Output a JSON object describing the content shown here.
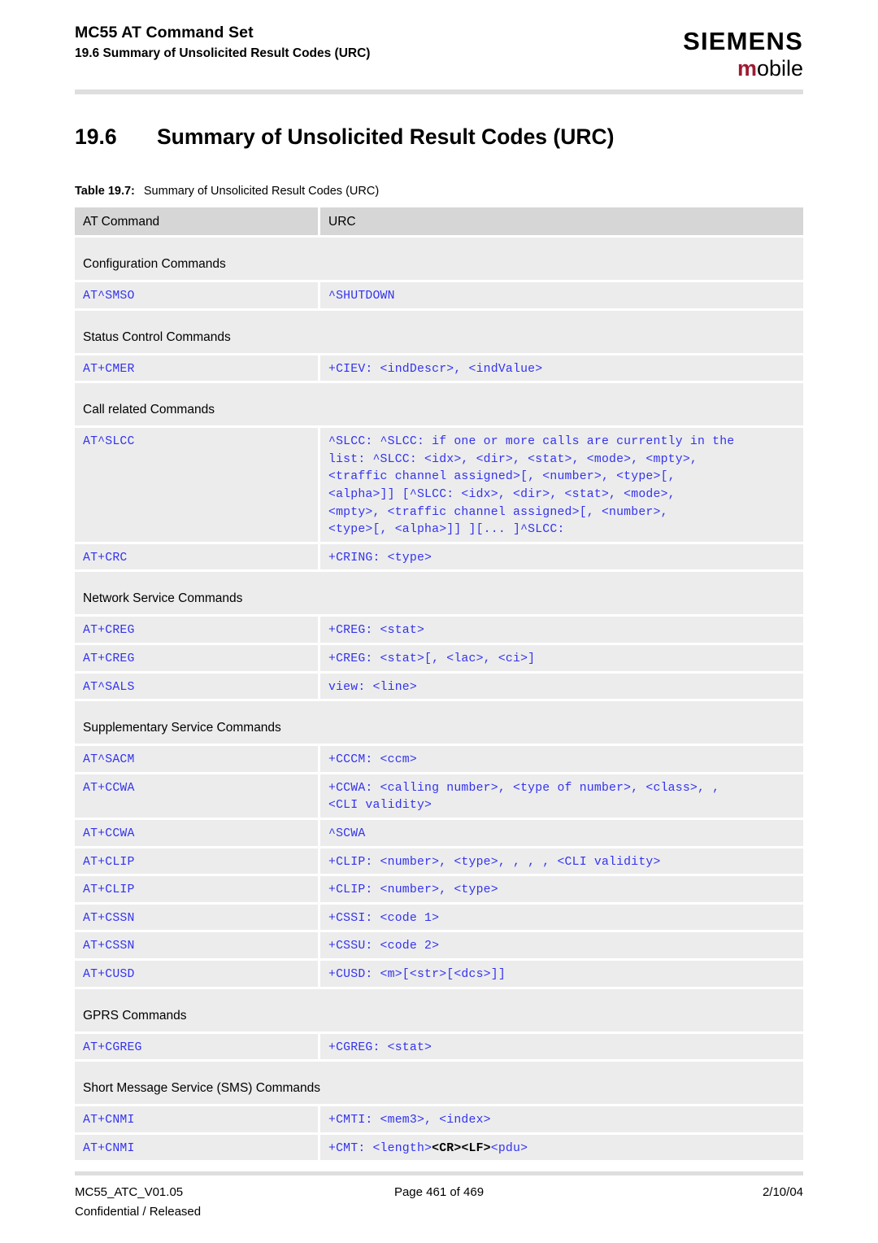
{
  "header": {
    "doc_title": "MC55 AT Command Set",
    "section_line": "19.6 Summary of Unsolicited Result Codes (URC)",
    "logo_primary": "SIEMENS",
    "logo_secondary_m": "m",
    "logo_secondary_rest": "obile",
    "brand_accent": "#9e1b32"
  },
  "title": {
    "number": "19.6",
    "text": "Summary of Unsolicited Result Codes (URC)"
  },
  "table_caption": {
    "label": "Table 19.7:",
    "text": "Summary of Unsolicited Result Codes (URC)"
  },
  "table": {
    "columns": [
      "AT Command",
      "URC"
    ],
    "rows": [
      {
        "kind": "section",
        "label": "Configuration Commands"
      },
      {
        "kind": "cmd",
        "command": "AT^SMSO",
        "urc": "^SHUTDOWN"
      },
      {
        "kind": "section",
        "label": "Status Control Commands"
      },
      {
        "kind": "cmd",
        "command": "AT+CMER",
        "urc": "+CIEV: <indDescr>, <indValue>"
      },
      {
        "kind": "section",
        "label": "Call related Commands"
      },
      {
        "kind": "cmd",
        "command": "AT^SLCC",
        "urc": "^SLCC: ^SLCC: if one or more calls are currently in the\nlist: ^SLCC: <idx>, <dir>, <stat>, <mode>, <mpty>,\n<traffic channel assigned>[, <number>, <type>[,\n<alpha>]] [^SLCC: <idx>, <dir>, <stat>, <mode>,\n<mpty>, <traffic channel assigned>[, <number>,\n<type>[, <alpha>]] ][... ]^SLCC:"
      },
      {
        "kind": "cmd",
        "command": "AT+CRC",
        "urc": "+CRING: <type>"
      },
      {
        "kind": "section",
        "label": "Network Service Commands"
      },
      {
        "kind": "cmd",
        "command": "AT+CREG",
        "urc": "+CREG: <stat>"
      },
      {
        "kind": "cmd",
        "command": "AT+CREG",
        "urc": "+CREG: <stat>[, <lac>, <ci>]"
      },
      {
        "kind": "cmd",
        "command": "AT^SALS",
        "urc": "view: <line>"
      },
      {
        "kind": "section",
        "label": "Supplementary Service Commands"
      },
      {
        "kind": "cmd",
        "command": "AT^SACM",
        "urc": "+CCCM: <ccm>"
      },
      {
        "kind": "cmd",
        "command": "AT+CCWA",
        "urc": "+CCWA: <calling number>, <type of number>, <class>, ,\n<CLI validity>"
      },
      {
        "kind": "cmd",
        "command": "AT+CCWA",
        "urc": "^SCWA"
      },
      {
        "kind": "cmd",
        "command": "AT+CLIP",
        "urc": "+CLIP: <number>, <type>, , , , <CLI validity>"
      },
      {
        "kind": "cmd",
        "command": "AT+CLIP",
        "urc": "+CLIP: <number>, <type>"
      },
      {
        "kind": "cmd",
        "command": "AT+CSSN",
        "urc": "+CSSI: <code 1>"
      },
      {
        "kind": "cmd",
        "command": "AT+CSSN",
        "urc": "+CSSU: <code 2>"
      },
      {
        "kind": "cmd",
        "command": "AT+CUSD",
        "urc": "+CUSD: <m>[<str>[<dcs>]]"
      },
      {
        "kind": "section",
        "label": "GPRS Commands"
      },
      {
        "kind": "cmd",
        "command": "AT+CGREG",
        "urc": "+CGREG: <stat>"
      },
      {
        "kind": "section",
        "label": "Short Message Service (SMS) Commands"
      },
      {
        "kind": "cmd",
        "command": "AT+CNMI",
        "urc": "+CMTI: <mem3>, <index>"
      },
      {
        "kind": "cmd",
        "command": "AT+CNMI",
        "urc_parts": [
          {
            "text": "+CMT: <length>",
            "bold": false
          },
          {
            "text": "<CR><LF>",
            "bold": true
          },
          {
            "text": "<pdu>",
            "bold": false
          }
        ],
        "urc": "+CMT: <length><CR><LF><pdu>"
      }
    ]
  },
  "footer": {
    "doc_id": "MC55_ATC_V01.05",
    "page": "Page 461 of 469",
    "date": "2/10/04",
    "classification": "Confidential / Released"
  },
  "colors": {
    "code_blue": "#3333ee",
    "row_bg": "#ececec",
    "header_row_bg": "#d6d6d6",
    "rule": "#dedede"
  }
}
